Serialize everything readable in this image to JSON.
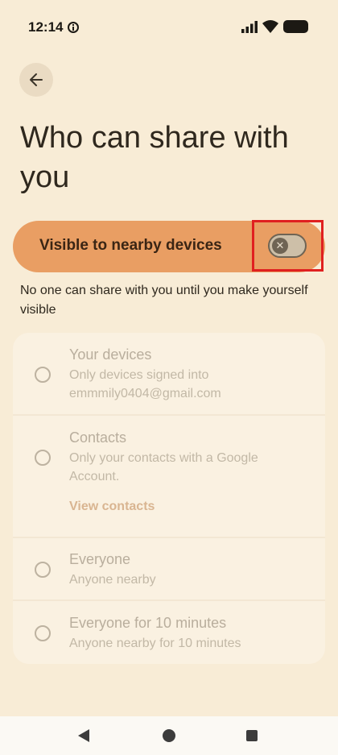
{
  "status_bar": {
    "time": "12:14"
  },
  "header": {
    "title": "Who can share with you"
  },
  "visibility_toggle": {
    "label": "Visible to nearby devices",
    "state": "off",
    "thumb_glyph": "✕"
  },
  "visibility_note": "No one can share with you until you make yourself visible",
  "options": [
    {
      "title": "Your devices",
      "description": "Only devices signed into emmmily0404@gmail.com"
    },
    {
      "title": "Contacts",
      "description": "Only your contacts with a Google Account.",
      "link": "View contacts"
    },
    {
      "title": "Everyone",
      "description": "Anyone nearby"
    },
    {
      "title": "Everyone for 10 minutes",
      "description": "Anyone nearby for 10 minutes"
    }
  ],
  "colors": {
    "background": "#f8ecd6",
    "toggle_row": "#e99e63",
    "highlight": "#e02020"
  },
  "icons": [
    "info-icon",
    "signal-icon",
    "wifi-icon",
    "battery-icon",
    "back-arrow-icon",
    "close-icon",
    "nav-back-icon",
    "nav-home-icon",
    "nav-recents-icon"
  ]
}
